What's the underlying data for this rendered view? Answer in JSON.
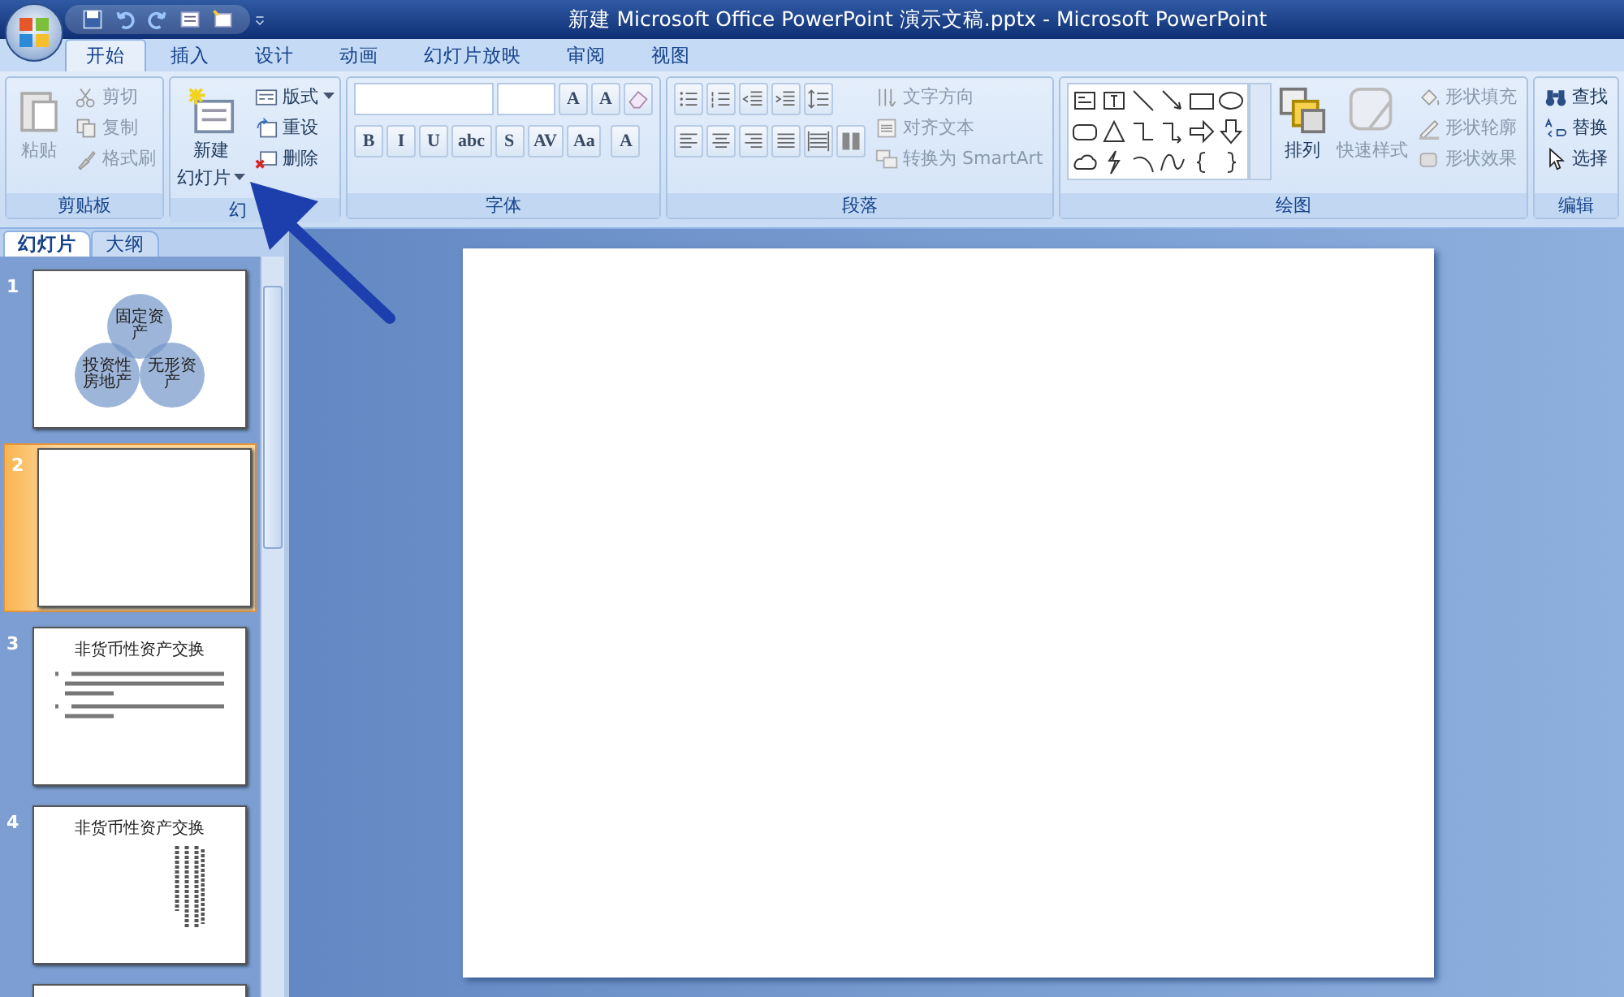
{
  "window": {
    "title": "新建 Microsoft Office PowerPoint 演示文稿.pptx - Microsoft PowerPoint"
  },
  "tabs": [
    {
      "label": "开始",
      "selected": true
    },
    {
      "label": "插入",
      "selected": false
    },
    {
      "label": "设计",
      "selected": false
    },
    {
      "label": "动画",
      "selected": false
    },
    {
      "label": "幻灯片放映",
      "selected": false
    },
    {
      "label": "审阅",
      "selected": false
    },
    {
      "label": "视图",
      "selected": false
    }
  ],
  "clipboard": {
    "label": "剪贴板",
    "paste": {
      "label": "粘贴",
      "disabled": true
    },
    "items": [
      {
        "label": "剪切",
        "disabled": true
      },
      {
        "label": "复制",
        "disabled": true
      },
      {
        "label": "格式刷",
        "disabled": true
      }
    ]
  },
  "slides_group": {
    "label": "幻",
    "new_slide": [
      "新建",
      "幻灯片"
    ],
    "items": [
      {
        "label": "版式",
        "dropdown": true
      },
      {
        "label": "重设",
        "dropdown": false
      },
      {
        "label": "删除",
        "dropdown": false
      }
    ]
  },
  "font": {
    "label": "字体",
    "size_buttons": [
      "A",
      "A"
    ],
    "format_buttons": [
      "B",
      "I",
      "U",
      "abc",
      "S",
      "AV",
      "Aa"
    ],
    "color_button": "A"
  },
  "paragraph": {
    "label": "段落",
    "items": [
      {
        "label": "文字方向",
        "disabled": true
      },
      {
        "label": "对齐文本",
        "disabled": true
      },
      {
        "label": "转换为 SmartArt",
        "disabled": true
      }
    ]
  },
  "drawing": {
    "label": "绘图",
    "arrange": "排列",
    "quick_styles": {
      "label": "快速样式",
      "disabled": true
    },
    "items": [
      {
        "label": "形状填充",
        "disabled": true
      },
      {
        "label": "形状轮廓",
        "disabled": true
      },
      {
        "label": "形状效果",
        "disabled": true
      }
    ]
  },
  "editing": {
    "label": "编辑",
    "items": [
      {
        "label": "查找"
      },
      {
        "label": "替换"
      },
      {
        "label": "选择"
      }
    ]
  },
  "panel_tabs": [
    {
      "label": "幻灯片",
      "selected": true
    },
    {
      "label": "大纲",
      "selected": false
    }
  ],
  "slides": [
    {
      "number": "1",
      "selected": false,
      "kind": "venn",
      "labels": [
        "固定资产",
        "投资性房地产",
        "无形资产"
      ]
    },
    {
      "number": "2",
      "selected": true,
      "kind": "blank"
    },
    {
      "number": "3",
      "selected": false,
      "kind": "text",
      "title": "非货币性资产交换"
    },
    {
      "number": "4",
      "selected": false,
      "kind": "vertical",
      "title": "非货币性资产交换"
    },
    {
      "selected": false,
      "kind": "blank"
    }
  ]
}
